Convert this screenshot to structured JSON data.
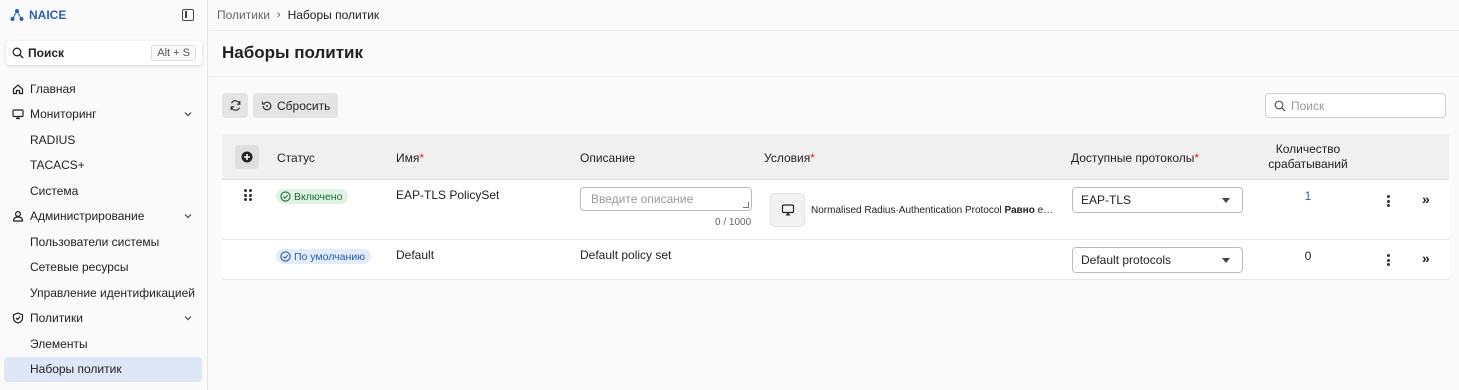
{
  "colors": {
    "accent": "#2c5fb5",
    "required": "#dd2233",
    "active_nav_bg": "#dde7f7",
    "enabled_badge": "#dff3e4",
    "default_badge": "#e3ecfb"
  },
  "app": {
    "brand": "NAICE"
  },
  "sidebar": {
    "search_label": "Поиск",
    "search_shortcut": "Alt + S",
    "items": [
      {
        "label": "Главная",
        "icon": "home-icon"
      },
      {
        "label": "Мониторинг",
        "icon": "monitor-icon",
        "expanded": true
      },
      {
        "label": "RADIUS"
      },
      {
        "label": "TACACS+"
      },
      {
        "label": "Система"
      },
      {
        "label": "Администрирование",
        "icon": "user-icon",
        "expanded": true
      },
      {
        "label": "Пользователи системы"
      },
      {
        "label": "Сетевые ресурсы"
      },
      {
        "label": "Управление идентификацией"
      },
      {
        "label": "Политики",
        "icon": "shield-icon",
        "expanded": true
      },
      {
        "label": "Элементы"
      },
      {
        "label": "Наборы политик",
        "active": true
      }
    ]
  },
  "breadcrumb": {
    "parent": "Политики",
    "current": "Наборы политик"
  },
  "page": {
    "title": "Наборы политик"
  },
  "toolbar": {
    "reset_label": "Сбросить",
    "search_placeholder": "Поиск"
  },
  "table": {
    "headers": {
      "status": "Статус",
      "name": "Имя",
      "description": "Описание",
      "conditions": "Условия",
      "protocols": "Доступные протоколы",
      "count_line1": "Количество",
      "count_line2": "срабатываний",
      "required_mark": "*"
    },
    "rows": [
      {
        "status": "Включено",
        "name": "EAP-TLS PolicySet",
        "description_placeholder": "Введите описание",
        "description_counter": "0 / 1000",
        "condition_prefix": "Normalised Radius·Authentication Protocol",
        "condition_op": "Равно",
        "condition_suffix": "e…",
        "protocol": "EAP-TLS",
        "count": "1"
      },
      {
        "status": "По умолчанию",
        "name": "Default",
        "description": "Default policy set",
        "protocol": "Default protocols",
        "count": "0"
      }
    ],
    "expand_glyph": "»"
  }
}
